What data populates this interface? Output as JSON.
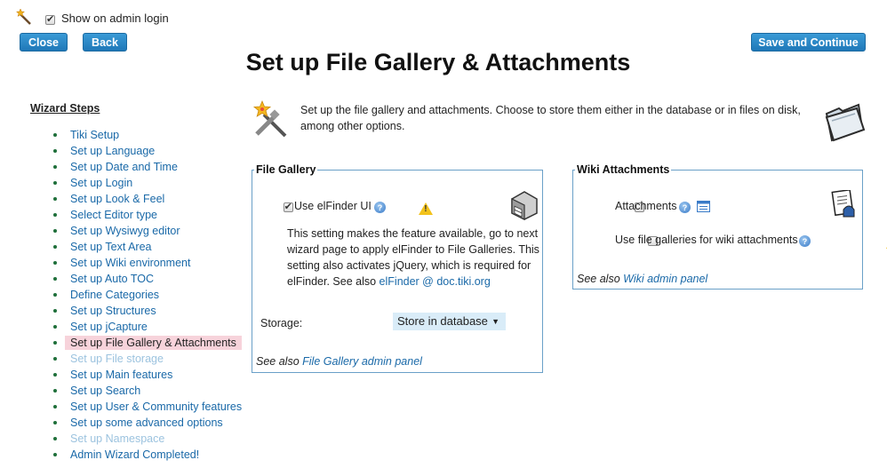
{
  "top": {
    "show_on_admin_login": "Show on admin login"
  },
  "buttons": {
    "close": "Close",
    "back": "Back",
    "save_continue": "Save and Continue"
  },
  "page_title": "Set up File Gallery & Attachments",
  "wizard_steps": {
    "title": "Wizard Steps",
    "items": [
      {
        "label": "Tiki Setup",
        "state": "link"
      },
      {
        "label": "Set up Language",
        "state": "link"
      },
      {
        "label": "Set up Date and Time",
        "state": "link"
      },
      {
        "label": "Set up Login",
        "state": "link"
      },
      {
        "label": "Set up Look & Feel",
        "state": "link"
      },
      {
        "label": "Select Editor type",
        "state": "link"
      },
      {
        "label": "Set up Wysiwyg editor",
        "state": "link"
      },
      {
        "label": "Set up Text Area",
        "state": "link"
      },
      {
        "label": "Set up Wiki environment",
        "state": "link"
      },
      {
        "label": "Set up Auto TOC",
        "state": "link"
      },
      {
        "label": "Define Categories",
        "state": "link"
      },
      {
        "label": "Set up Structures",
        "state": "link"
      },
      {
        "label": "Set up jCapture",
        "state": "link"
      },
      {
        "label": "Set up File Gallery & Attachments",
        "state": "active"
      },
      {
        "label": "Set up File storage",
        "state": "disabled"
      },
      {
        "label": "Set up Main features",
        "state": "link"
      },
      {
        "label": "Set up Search",
        "state": "link"
      },
      {
        "label": "Set up User & Community features",
        "state": "link"
      },
      {
        "label": "Set up some advanced options",
        "state": "link"
      },
      {
        "label": "Set up Namespace",
        "state": "disabled"
      },
      {
        "label": "Admin Wizard Completed!",
        "state": "link"
      }
    ]
  },
  "intro": {
    "text_line1": "Set up the file gallery and attachments. Choose to store them either in the database or in files on disk,",
    "text_line2": "among other options."
  },
  "file_gallery": {
    "legend": "File Gallery",
    "use_elfinder_label": "Use elFinder UI",
    "use_elfinder_checked": true,
    "desc_line1": "This setting makes the feature available, go to next",
    "desc_line2": "wizard page to apply elFinder to File Galleries. This",
    "desc_line3": "setting also activates jQuery, which is required for",
    "desc_line4_prefix": "elFinder. See also",
    "desc_link": "elFinder @ doc.tiki.org",
    "storage_label": "Storage:",
    "storage_value": "Store in database",
    "see_also_prefix": "See also",
    "see_also_link": "File Gallery admin panel"
  },
  "wiki_attachments": {
    "legend": "Wiki Attachments",
    "attachments_label": "Attachments",
    "attachments_checked": false,
    "use_galleries_label": "Use file galleries for wiki attachments",
    "use_galleries_checked": false,
    "see_also_prefix": "See also",
    "see_also_link": "Wiki admin panel"
  },
  "colors": {
    "accent": "#1f78b8",
    "link": "#1a69a8",
    "active_step_bg": "#f7d3db",
    "fieldset_border": "#6aa0c8"
  }
}
